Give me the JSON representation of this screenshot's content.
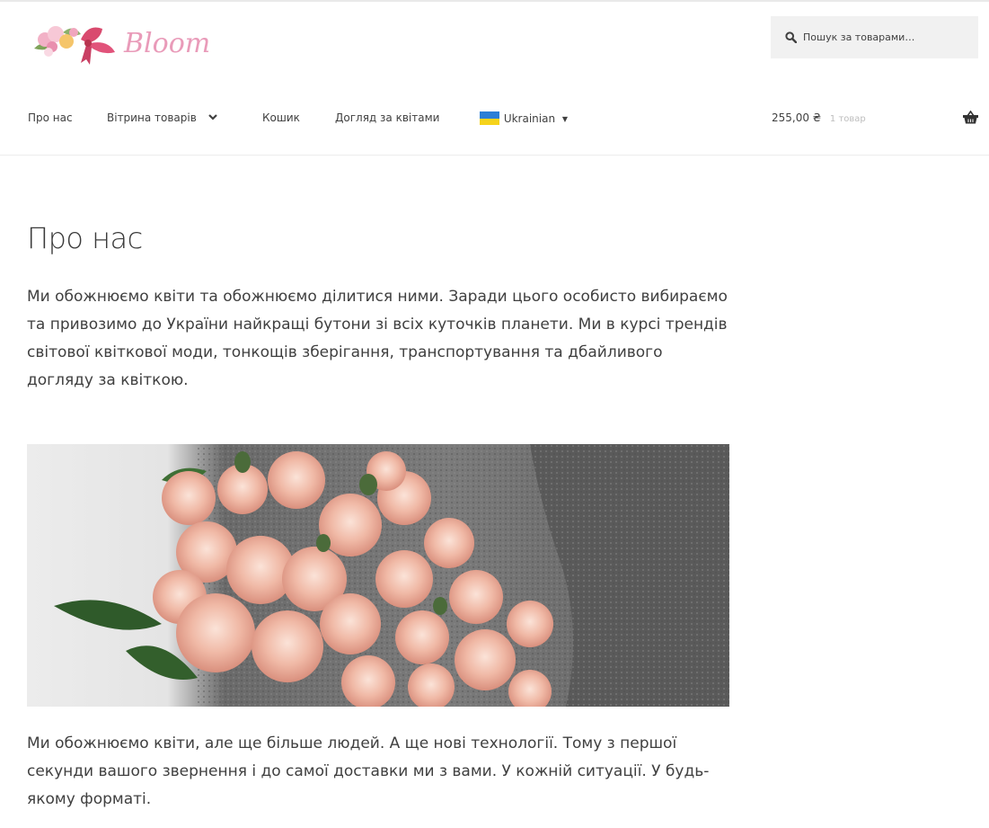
{
  "brand": {
    "name": "Bloom"
  },
  "search": {
    "placeholder": "Пошук за товарами…",
    "icon": "search-icon"
  },
  "nav": {
    "items": [
      {
        "label": "Про нас"
      },
      {
        "label": "Вітрина товарів",
        "has_dropdown": true
      },
      {
        "label": "Кошик"
      },
      {
        "label": "Догляд за квітами"
      }
    ],
    "language": {
      "label": "Ukrainian",
      "flag": "ukraine-flag"
    }
  },
  "cart": {
    "amount": "255,00 ₴",
    "count": "1 товар",
    "icon": "basket-icon"
  },
  "page": {
    "title": "Про нас",
    "paragraph1": "Ми обожнюємо квіти та обожнюємо ділитися ними. Заради цього особисто вибираємо та привозимо до України найкращі бутони зі всіх куточків планети. Ми в курсі трендів світової квіткової моди, тонкощів зберігання, транспортування та дбайливого догляду за квіткою.",
    "paragraph2": "Ми обожнюємо квіти, але ще більше людей. А ще нові технології. Тому з першої секунди вашого звернення і до самої доставки ми з вами. У кожній ситуації. У будь-якому форматі."
  },
  "colors": {
    "brand_pink": "#d46a9a",
    "text": "#404040",
    "search_bg": "#f1f1f1"
  }
}
